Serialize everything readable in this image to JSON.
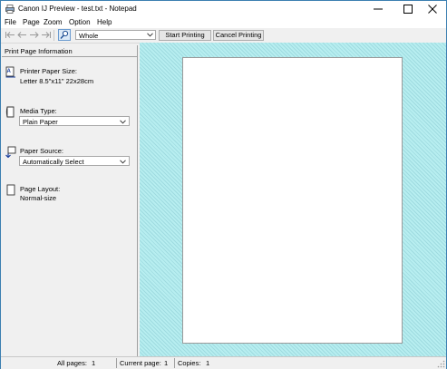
{
  "window": {
    "title": "Canon IJ Preview - test.txt - Notepad"
  },
  "menu": [
    "File",
    "Page",
    "Zoom",
    "Option",
    "Help"
  ],
  "toolbar": {
    "zoom_value": "Whole",
    "start_label": "Start Printing",
    "cancel_label": "Cancel Printing"
  },
  "panel": {
    "header": "Print Page Information",
    "paper_size_label": "Printer Paper Size:",
    "paper_size_value": "Letter 8.5\"x11\" 22x28cm",
    "media_type_label": "Media Type:",
    "media_type_value": "Plain Paper",
    "paper_source_label": "Paper Source:",
    "paper_source_value": "Automatically Select",
    "page_layout_label": "Page Layout:",
    "page_layout_value": "Normal-size"
  },
  "status": {
    "all_pages_label": "All pages:",
    "all_pages_value": "1",
    "current_page_label": "Current page:",
    "current_page_value": "1",
    "copies_label": "Copies:",
    "copies_value": "1"
  },
  "colors": {
    "preview_background": "#b7eef0",
    "window_border": "#3c7fb1"
  }
}
